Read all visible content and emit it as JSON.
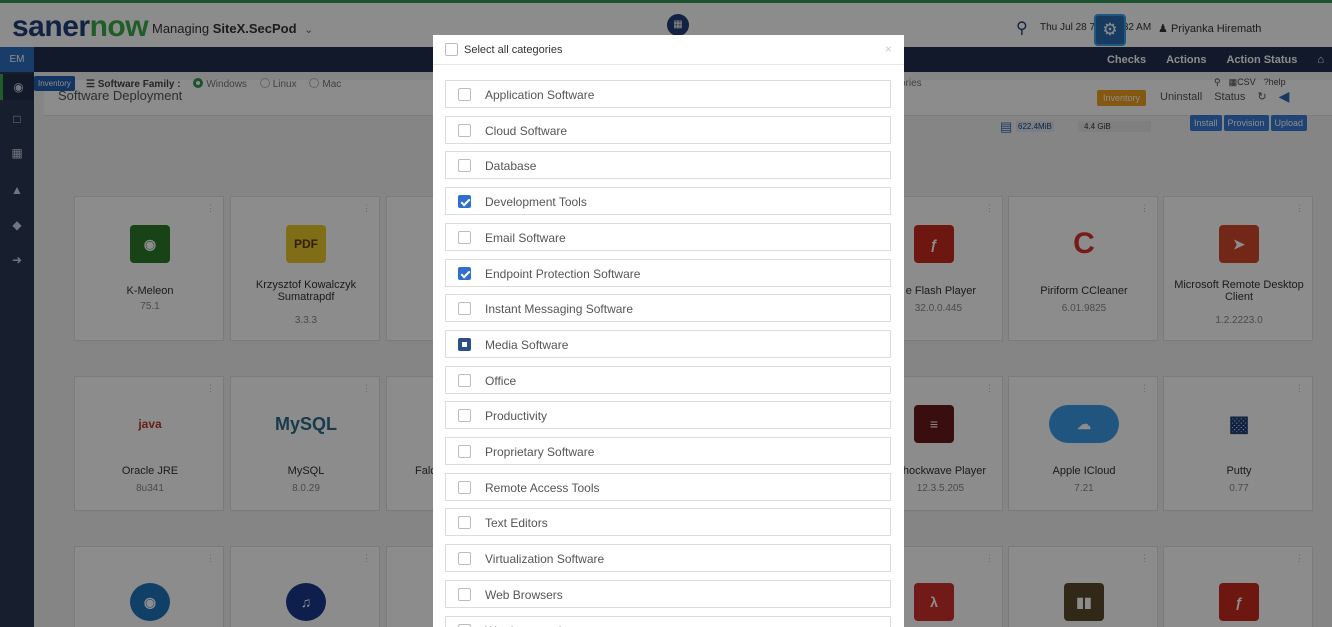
{
  "header": {
    "logo_saner": "saner",
    "logo_now": "now",
    "managing_label": "Managing",
    "site_name": "SiteX.SecPod",
    "datetime": "Thu Jul 28  7 : 49 : 32 AM",
    "user_name": "Priyanka Hiremath"
  },
  "navbar": {
    "em_tag": "EM",
    "links": [
      "Checks",
      "Actions",
      "Action Status"
    ]
  },
  "panel": {
    "title": "Software Deployment",
    "inventory_btn": "Inventory",
    "uninstall": "Uninstall",
    "status": "Status",
    "storage_used": "622.4MiB",
    "storage_total": "4.4 GiB",
    "install_btn": "Install",
    "provision_btn": "Provision",
    "upload_btn": "Upload"
  },
  "filters": {
    "inventory_badge": "Inventory",
    "family_label": "Software Family :",
    "options": [
      "Windows",
      "Linux",
      "Mac"
    ],
    "selected": "Windows",
    "categories_fragment": "ories",
    "csv": "CSV",
    "help": "help"
  },
  "tiles": [
    {
      "name": "K-Meleon",
      "version": "75.1"
    },
    {
      "name": "Krzysztof Kowalczyk Sumatrapdf",
      "version": "3.3.3"
    },
    {
      "name": "e Flash Player",
      "version": "32.0.0.445"
    },
    {
      "name": "Piriform CCleaner",
      "version": "6.01.9825"
    },
    {
      "name": "Microsoft Remote Desktop Client",
      "version": "1.2.2223.0"
    },
    {
      "name": "Oracle JRE",
      "version": "8u341"
    },
    {
      "name": "MySQL",
      "version": "8.0.29"
    },
    {
      "name": "Falc",
      "version": ""
    },
    {
      "name": "hockwave Player",
      "version": "12.3.5.205"
    },
    {
      "name": "Apple ICloud",
      "version": "7.21"
    },
    {
      "name": "Putty",
      "version": "0.77"
    }
  ],
  "modal": {
    "select_all_label": "Select all categories",
    "categories": [
      {
        "label": "Application Software",
        "state": "off"
      },
      {
        "label": "Cloud Software",
        "state": "off"
      },
      {
        "label": "Database",
        "state": "off"
      },
      {
        "label": "Development Tools",
        "state": "on"
      },
      {
        "label": "Email Software",
        "state": "off"
      },
      {
        "label": "Endpoint Protection Software",
        "state": "on"
      },
      {
        "label": "Instant Messaging Software",
        "state": "off"
      },
      {
        "label": "Media Software",
        "state": "mixed"
      },
      {
        "label": "Office",
        "state": "off"
      },
      {
        "label": "Productivity",
        "state": "off"
      },
      {
        "label": "Proprietary Software",
        "state": "off"
      },
      {
        "label": "Remote Access Tools",
        "state": "off"
      },
      {
        "label": "Text Editors",
        "state": "off"
      },
      {
        "label": "Virtualization Software",
        "state": "off"
      },
      {
        "label": "Web Browsers",
        "state": "off"
      },
      {
        "label": "Word processing",
        "state": "off"
      }
    ]
  },
  "colors": {
    "brand_blue": "#1f3e78",
    "brand_green": "#3ba94a",
    "checkbox_checked": "#2f6fcf"
  }
}
